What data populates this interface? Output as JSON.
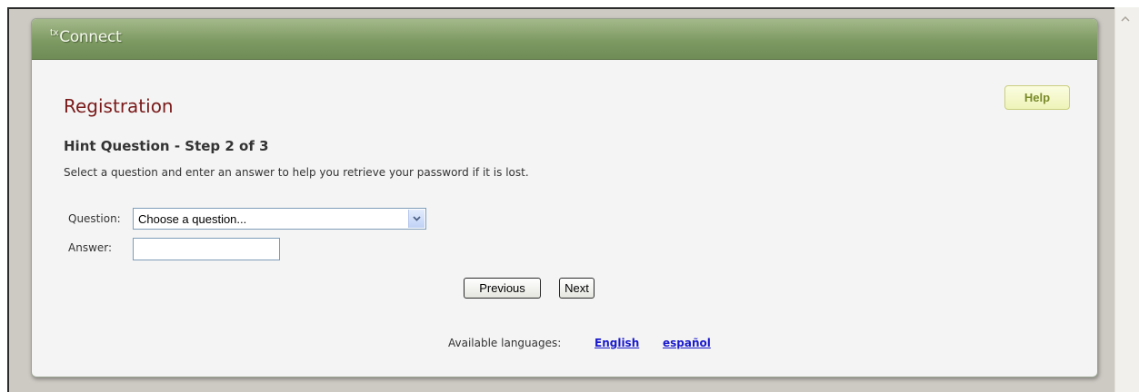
{
  "header": {
    "logo_prefix": "tx",
    "logo_text": "Connect"
  },
  "help_button": "Help",
  "page_title": "Registration",
  "step_heading": "Hint Question - Step 2 of 3",
  "instructions": "Select a question and enter an answer to help you retrieve your password if it is lost.",
  "form": {
    "question_label": "Question:",
    "question_value": "Choose a question...",
    "answer_label": "Answer:",
    "answer_value": ""
  },
  "buttons": {
    "previous": "Previous",
    "next": "Next"
  },
  "languages": {
    "label": "Available languages:",
    "options": [
      "English",
      "español"
    ]
  },
  "colors": {
    "header_green": "#7e9a63",
    "title_red": "#7a1a1a",
    "link_blue": "#1a1acc",
    "help_text": "#7a8b2a"
  }
}
